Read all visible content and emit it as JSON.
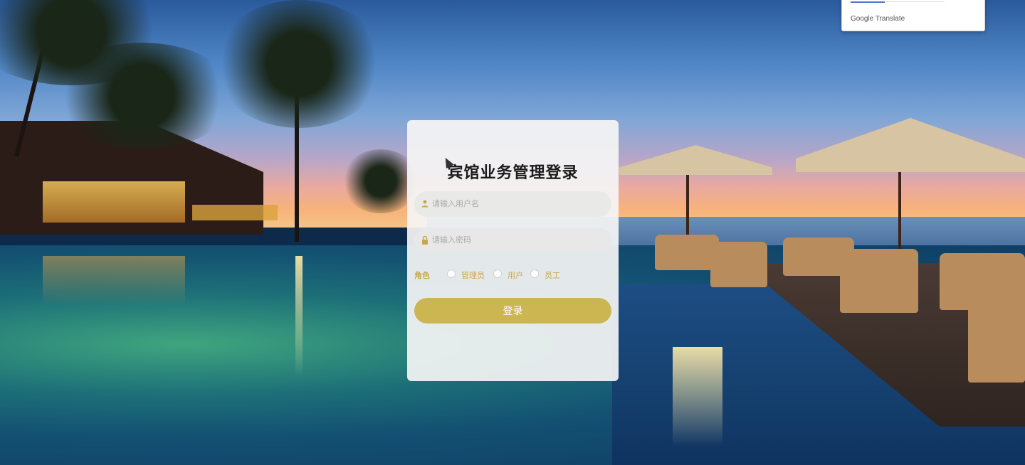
{
  "popup": {
    "label": "Google Translate"
  },
  "login": {
    "title": "宾馆业务管理登录",
    "username_placeholder": "请输入用户名",
    "password_placeholder": "请输入密码",
    "role_label": "角色",
    "roles": [
      {
        "label": "管理员"
      },
      {
        "label": "用户"
      },
      {
        "label": "员工"
      }
    ],
    "submit_label": "登录"
  },
  "icons": {
    "username": "user-icon",
    "password": "lock-icon"
  },
  "colors": {
    "button": "#cbb652",
    "role_text": "#c9a64b",
    "card_bg": "#f5f5f5"
  }
}
